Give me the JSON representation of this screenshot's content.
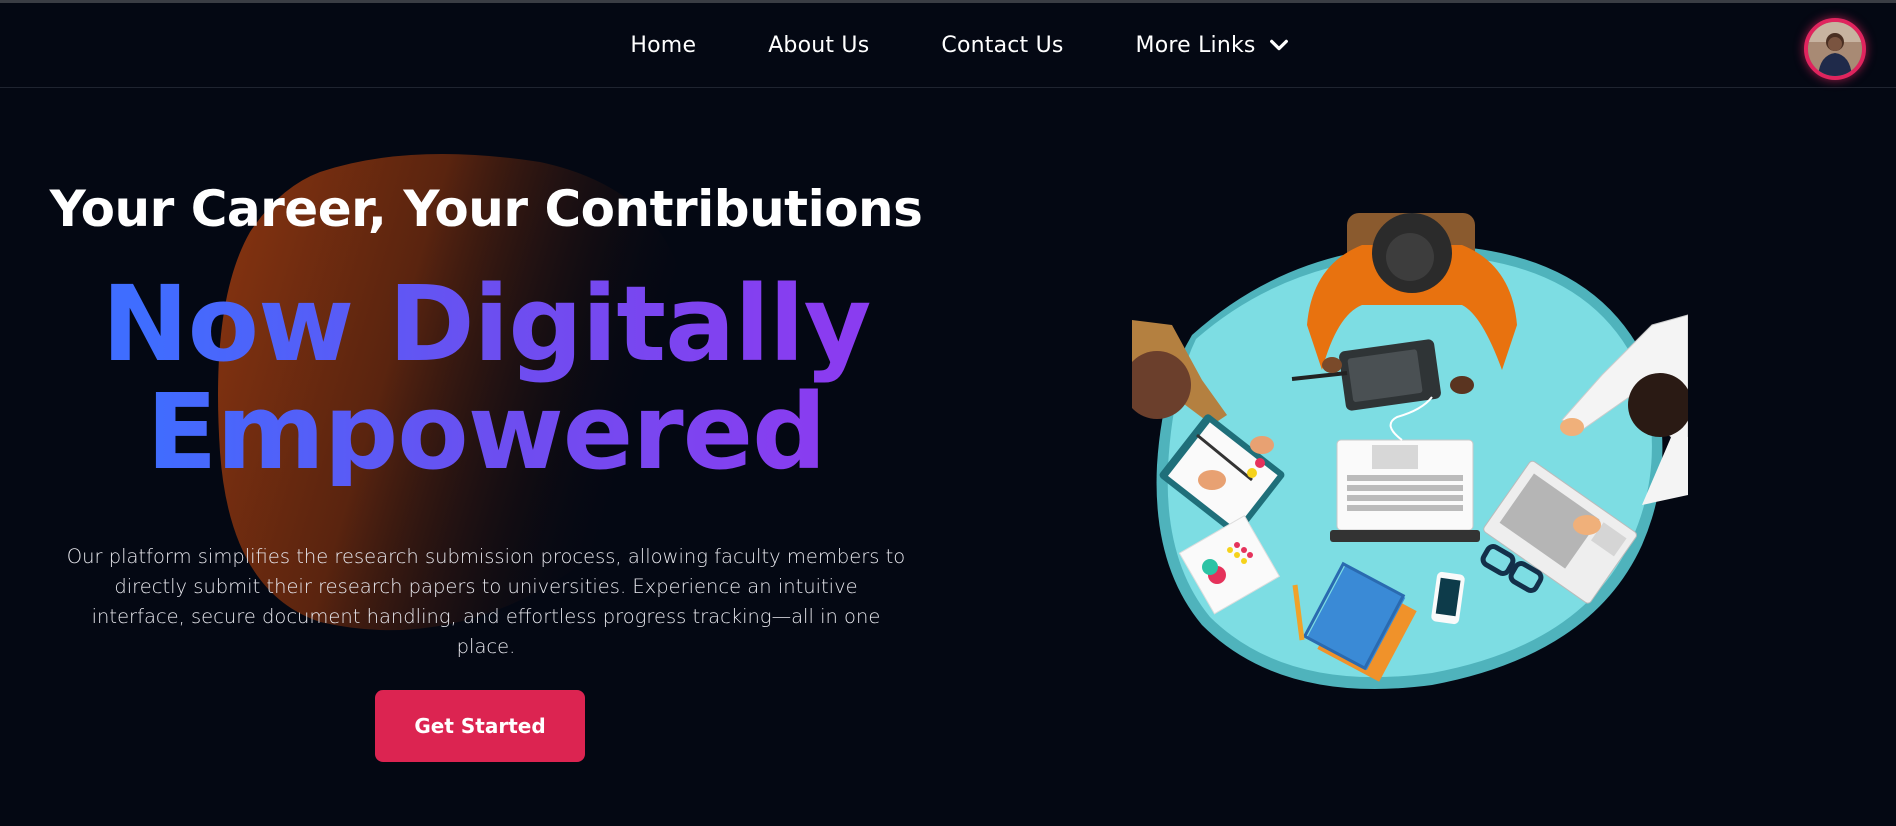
{
  "nav": {
    "items": [
      {
        "label": "Home"
      },
      {
        "label": "About Us"
      },
      {
        "label": "Contact Us"
      }
    ],
    "more_label": "More Links",
    "more_icon": "chevron-down-icon"
  },
  "profile": {
    "icon": "user-avatar"
  },
  "hero": {
    "title": "Your Career, Your Contributions",
    "accent_line1": "Now Digitally",
    "accent_line2": "Empowered",
    "description": "Our platform simplifies the research submission process, allowing faculty members to directly submit their research papers to universities. Experience an intuitive interface, secure document handling, and effortless progress tracking—all in one place.",
    "cta_label": "Get Started"
  },
  "colors": {
    "background": "#040813",
    "cta": "#dc2451",
    "accent_gradient_start": "#3f6dff",
    "accent_gradient_end": "#8a3cf0",
    "avatar_ring": "#e0245e",
    "table": "#7ddde3"
  }
}
